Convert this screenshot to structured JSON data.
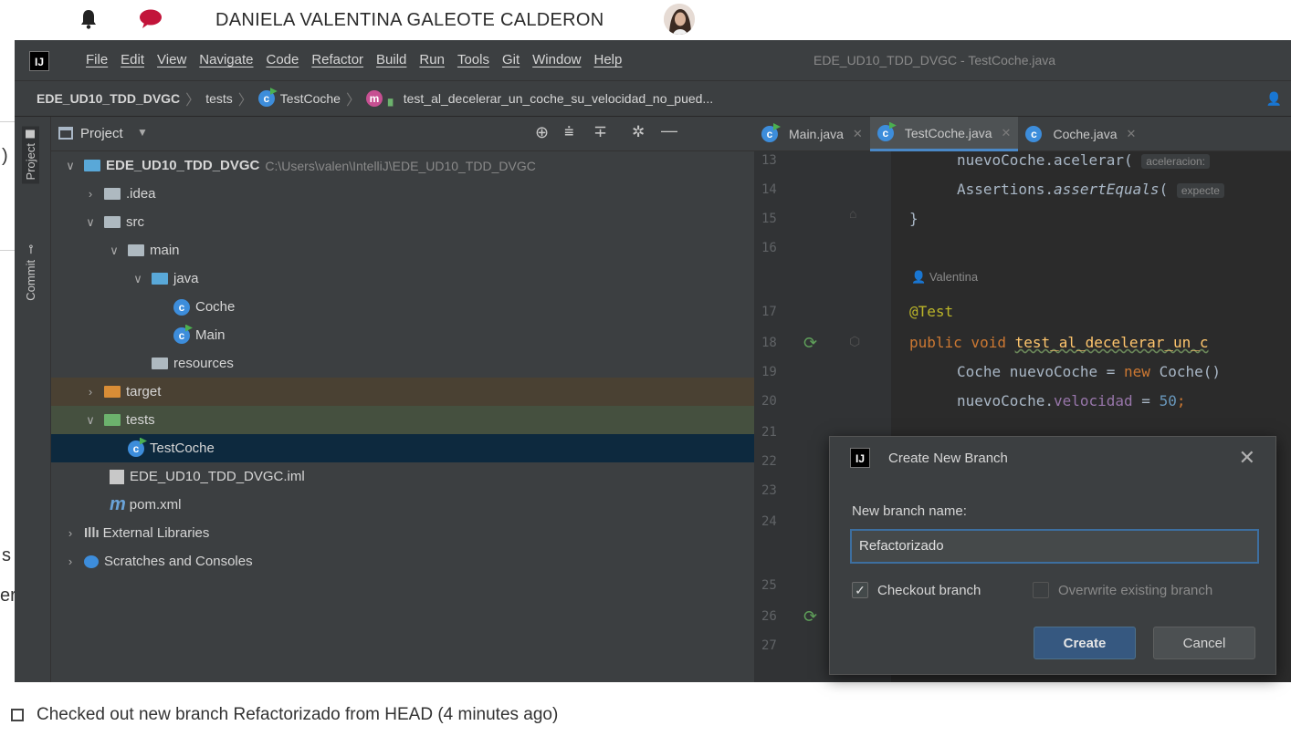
{
  "top": {
    "user_name": "DANIELA VALENTINA GALEOTE CALDERON",
    "icons": [
      "bell-icon",
      "chat-bubble-icon",
      "user-avatar"
    ]
  },
  "left_strip_chars": [
    ")",
    "s",
    "er"
  ],
  "ide": {
    "menu": [
      "File",
      "Edit",
      "View",
      "Navigate",
      "Code",
      "Refactor",
      "Build",
      "Run",
      "Tools",
      "Git",
      "Window",
      "Help"
    ],
    "window_title": "EDE_UD10_TDD_DVGC - TestCoche.java",
    "breadcrumb": {
      "project": "EDE_UD10_TDD_DVGC",
      "folder": "tests",
      "class": "TestCoche",
      "method": "test_al_decelerar_un_coche_su_velocidad_no_pued..."
    },
    "tool_tabs": [
      "Project",
      "Commit"
    ],
    "project_panel": {
      "title": "Project",
      "tree": [
        {
          "label": "EDE_UD10_TDD_DVGC",
          "path": "C:\\Users\\valen\\IntelliJ\\EDE_UD10_TDD_DVGC"
        },
        {
          "label": ".idea"
        },
        {
          "label": "src"
        },
        {
          "label": "main"
        },
        {
          "label": "java"
        },
        {
          "label": "Coche"
        },
        {
          "label": "Main"
        },
        {
          "label": "resources"
        },
        {
          "label": "target"
        },
        {
          "label": "tests"
        },
        {
          "label": "TestCoche"
        },
        {
          "label": "EDE_UD10_TDD_DVGC.iml"
        },
        {
          "label": "pom.xml"
        },
        {
          "label": "External Libraries"
        },
        {
          "label": "Scratches and Consoles"
        }
      ]
    },
    "editor_tabs": [
      "Main.java",
      "TestCoche.java",
      "Coche.java"
    ],
    "line_numbers": [
      "13",
      "14",
      "15",
      "16",
      "17",
      "18",
      "19",
      "20",
      "21",
      "22",
      "23",
      "24",
      "25",
      "26",
      "27"
    ],
    "code": {
      "l13_a": "nuevoCoche.acelerar(",
      "l13_hint": "aceleracion:",
      "l14_a": "Assertions.",
      "l14_b": "assertEquals",
      "l14_c": "(",
      "l14_hint": "expecte",
      "l15": "}",
      "author": "Valentina",
      "l17": "@Test",
      "l18_kw": "public void ",
      "l18_fn": "test_al_decelerar_un_c",
      "l19_a": "Coche nuevoCoche = ",
      "l19_kw": "new ",
      "l19_b": "Coche()",
      "l20_a": "nuevoCoche.",
      "l20_f": "velocidad",
      "l20_b": " = ",
      "l20_n": "50",
      "l20_c": ";"
    },
    "dialog": {
      "title": "Create New Branch",
      "label": "New branch name:",
      "value": "Refactorizado",
      "checkout_label": "Checkout branch",
      "overwrite_label": "Overwrite existing branch",
      "create_label": "Create",
      "cancel_label": "Cancel"
    }
  },
  "status": {
    "message": "Checked out new branch Refactorizado from HEAD (4 minutes ago)"
  }
}
